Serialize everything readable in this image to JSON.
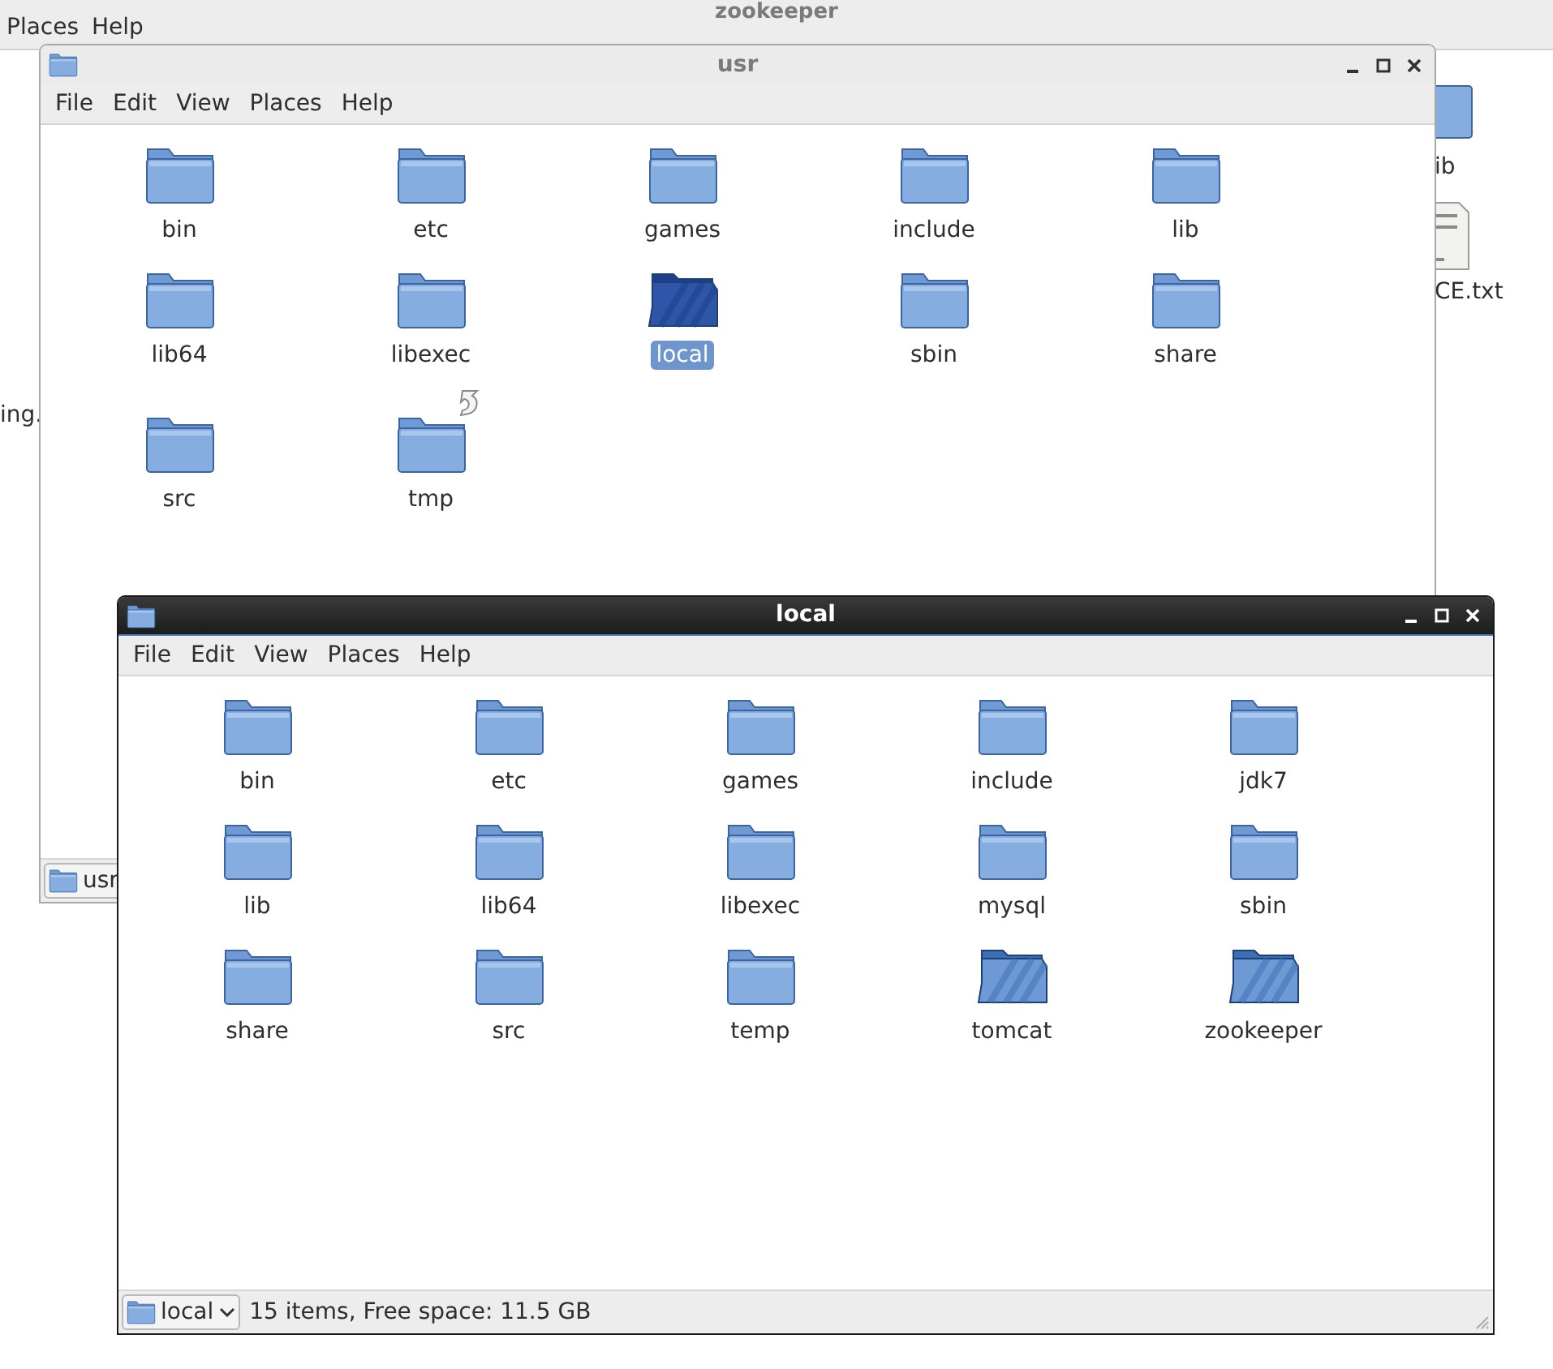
{
  "background_window": {
    "title": "zookeeper",
    "menu": [
      "Places",
      "Help"
    ],
    "left_label": "ing.",
    "icons": [
      {
        "label": "ib",
        "kind": "folder"
      },
      {
        "label": "CE.txt",
        "kind": "text-file"
      }
    ]
  },
  "windows": [
    {
      "title": "usr",
      "active": false,
      "menu": [
        "File",
        "Edit",
        "View",
        "Places",
        "Help"
      ],
      "items": [
        {
          "label": "bin",
          "kind": "folder",
          "selected": false,
          "emblem": false
        },
        {
          "label": "etc",
          "kind": "folder",
          "selected": false,
          "emblem": false
        },
        {
          "label": "games",
          "kind": "folder",
          "selected": false,
          "emblem": false
        },
        {
          "label": "include",
          "kind": "folder",
          "selected": false,
          "emblem": false
        },
        {
          "label": "lib",
          "kind": "folder",
          "selected": false,
          "emblem": false
        },
        {
          "label": "lib64",
          "kind": "folder",
          "selected": false,
          "emblem": false
        },
        {
          "label": "libexec",
          "kind": "folder",
          "selected": false,
          "emblem": false
        },
        {
          "label": "local",
          "kind": "open-folder",
          "selected": true,
          "emblem": false
        },
        {
          "label": "sbin",
          "kind": "folder",
          "selected": false,
          "emblem": false
        },
        {
          "label": "share",
          "kind": "folder",
          "selected": false,
          "emblem": false
        },
        {
          "label": "src",
          "kind": "folder",
          "selected": false,
          "emblem": false
        },
        {
          "label": "tmp",
          "kind": "folder",
          "selected": false,
          "emblem": true
        }
      ],
      "status": {
        "location": "usr"
      }
    },
    {
      "title": "local",
      "active": true,
      "menu": [
        "File",
        "Edit",
        "View",
        "Places",
        "Help"
      ],
      "items": [
        {
          "label": "bin",
          "kind": "folder",
          "selected": false,
          "emblem": false
        },
        {
          "label": "etc",
          "kind": "folder",
          "selected": false,
          "emblem": false
        },
        {
          "label": "games",
          "kind": "folder",
          "selected": false,
          "emblem": false
        },
        {
          "label": "include",
          "kind": "folder",
          "selected": false,
          "emblem": false
        },
        {
          "label": "jdk7",
          "kind": "folder",
          "selected": false,
          "emblem": false
        },
        {
          "label": "lib",
          "kind": "folder",
          "selected": false,
          "emblem": false
        },
        {
          "label": "lib64",
          "kind": "folder",
          "selected": false,
          "emblem": false
        },
        {
          "label": "libexec",
          "kind": "folder",
          "selected": false,
          "emblem": false
        },
        {
          "label": "mysql",
          "kind": "folder",
          "selected": false,
          "emblem": false
        },
        {
          "label": "sbin",
          "kind": "folder",
          "selected": false,
          "emblem": false
        },
        {
          "label": "share",
          "kind": "folder",
          "selected": false,
          "emblem": false
        },
        {
          "label": "src",
          "kind": "folder",
          "selected": false,
          "emblem": false
        },
        {
          "label": "temp",
          "kind": "folder",
          "selected": false,
          "emblem": false
        },
        {
          "label": "tomcat",
          "kind": "open-folder",
          "selected": false,
          "emblem": false
        },
        {
          "label": "zookeeper",
          "kind": "open-folder",
          "selected": false,
          "emblem": false
        }
      ],
      "status": {
        "location": "local",
        "summary": "15 items, Free space: 11.5 GB"
      }
    }
  ]
}
